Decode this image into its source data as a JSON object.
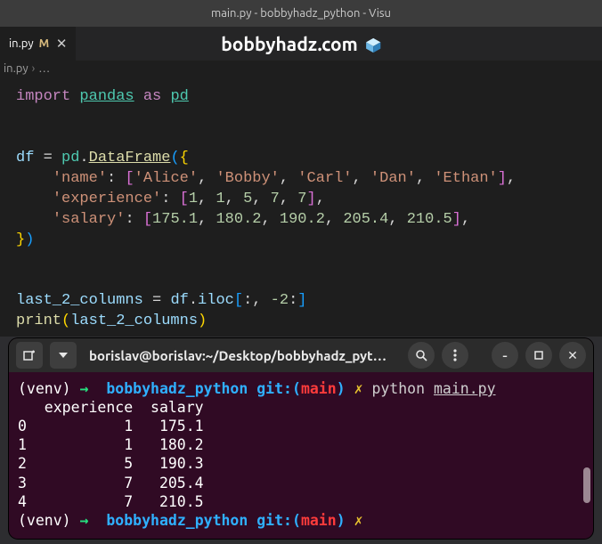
{
  "window": {
    "title": "main.py - bobbyhadz_python - Visu"
  },
  "tab": {
    "filename": "in.py",
    "modified_marker": "M",
    "close_glyph": "✕"
  },
  "brand": {
    "text": "bobbyhadz.com"
  },
  "breadcrumb": {
    "file": "in.py",
    "sep": "›",
    "more": "…"
  },
  "code": {
    "l1_import": "import",
    "l1_pandas": "pandas",
    "l1_as": "as",
    "l1_pd": "pd",
    "l3_df": "df",
    "l3_eq": " = ",
    "l3_pd": "pd",
    "l3_dot": ".",
    "l3_dataframe": "DataFrame",
    "l3_open": "({",
    "l4_key": "'name'",
    "l4_vals": "['Alice', 'Bobby', 'Carl', 'Dan', 'Ethan']",
    "l5_key": "'experience'",
    "l5_vals": "[1, 1, 5, 7, 7]",
    "l6_key": "'salary'",
    "l6_vals": "[175.1, 180.2, 190.2, 205.4, 210.5]",
    "l7_close": "})",
    "l9_var": "last_2_columns",
    "l9_rhs_a": "df",
    "l9_rhs_b": "iloc",
    "l9_slice": "[:, -2:]",
    "l10_print": "print",
    "l10_arg": "last_2_columns"
  },
  "terminal": {
    "header": {
      "title": "borislav@borislav:~/Desktop/bobbyhadz_pyt…"
    },
    "prompt": {
      "venv": "(venv)",
      "arrow": "→",
      "cwd": "bobbyhadz_python",
      "git": "git:",
      "branch": "main",
      "lightning": "✗",
      "cmd_python": "python",
      "cmd_file": "main.py"
    },
    "output": {
      "header": "   experience  salary",
      "r0": "0           1   175.1",
      "r1": "1           1   180.2",
      "r2": "2           5   190.3",
      "r3": "3           7   205.4",
      "r4": "4           7   210.5"
    }
  },
  "chart_data": {
    "type": "table",
    "title": "last_2_columns (df.iloc[:, -2:])",
    "columns": [
      "experience",
      "salary"
    ],
    "index": [
      0,
      1,
      2,
      3,
      4
    ],
    "rows": [
      [
        1,
        175.1
      ],
      [
        1,
        180.2
      ],
      [
        5,
        190.3
      ],
      [
        7,
        205.4
      ],
      [
        7,
        210.5
      ]
    ]
  }
}
